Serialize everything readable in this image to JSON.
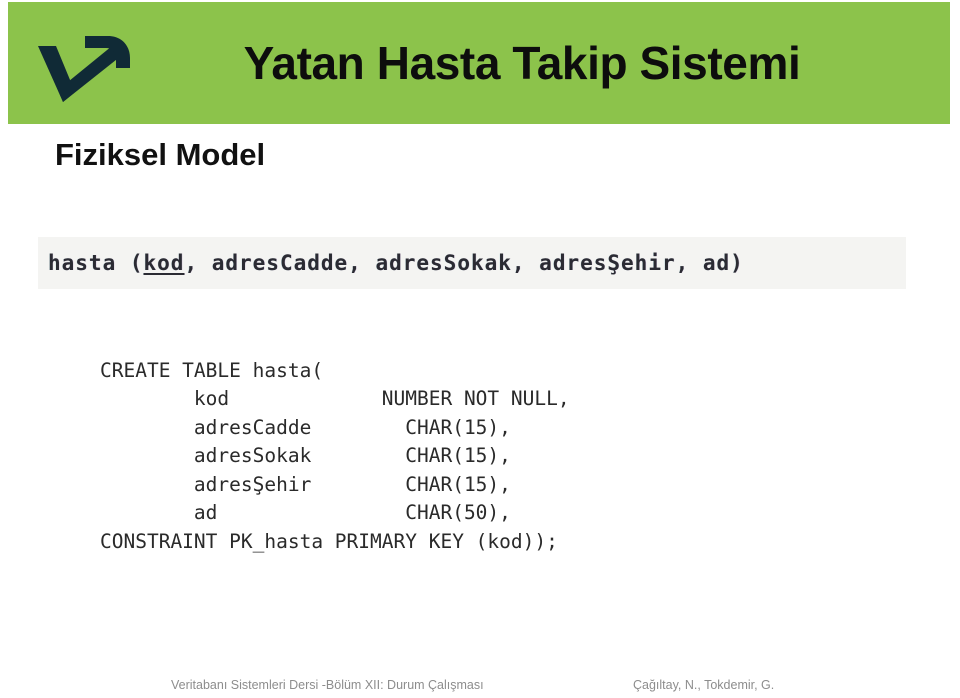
{
  "slide": {
    "banner": {
      "title": "Yatan Hasta Takip Sistemi",
      "background_color": "#8CC34B",
      "logo_name": "company-v-arrow-logo",
      "logo_color": "#102a36"
    },
    "section_heading": "Fiziksel Model",
    "schema": {
      "caption_prefix": "hasta (",
      "primary_key": "kod",
      "caption_suffix": ", adresCadde, adresSokak, adresŞehir, ad)",
      "full_text": "hasta (kod, adresCadde, adresSokak, adresŞehir, ad)",
      "background_color": "#f4f4f2"
    },
    "sql": {
      "language": "SQL",
      "lines": [
        "CREATE TABLE hasta(",
        "        kod             NUMBER NOT NULL,",
        "        adresCadde        CHAR(15),",
        "        adresSokak        CHAR(15),",
        "        adresŞehir        CHAR(15),",
        "        ad                CHAR(50),",
        "CONSTRAINT PK_hasta PRIMARY KEY (kod));"
      ],
      "text": "CREATE TABLE hasta(\n        kod             NUMBER NOT NULL,\n        adresCadde        CHAR(15),\n        adresSokak        CHAR(15),\n        adresŞehir        CHAR(15),\n        ad                CHAR(50),\nCONSTRAINT PK_hasta PRIMARY KEY (kod));"
    },
    "footer": {
      "left": "Veritabanı Sistemleri Dersi  -Bölüm XII: Durum Çalışması",
      "right": "Çağıltay, N., Tokdemir, G.",
      "text_color": "#8d8d8d"
    }
  }
}
